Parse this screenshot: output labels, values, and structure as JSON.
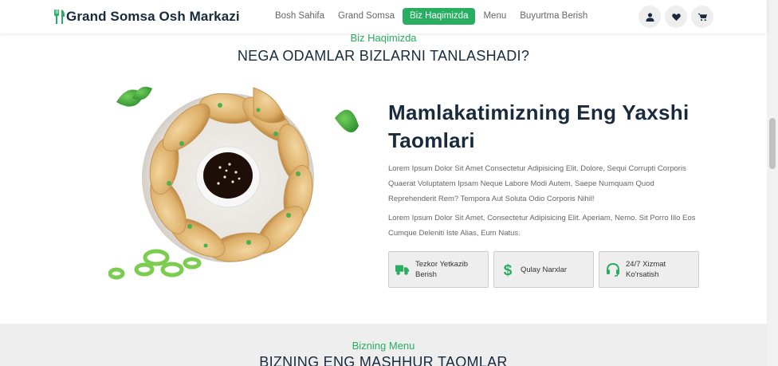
{
  "header": {
    "brand": "Grand Somsa Osh Markazi",
    "nav": [
      {
        "label": "Bosh Sahifa",
        "active": false
      },
      {
        "label": "Grand Somsa",
        "active": false
      },
      {
        "label": "Biz Haqimizda",
        "active": true
      },
      {
        "label": "Menu",
        "active": false
      },
      {
        "label": "Buyurtma Berish",
        "active": false
      }
    ],
    "icons": [
      "user-icon",
      "heart-icon",
      "cart-icon"
    ]
  },
  "about": {
    "subheading": "Biz Haqimizda",
    "heading": "NEGA ODAMLAR BIZLARNI TANLASHADI?",
    "title_line1": "Mamlakatimizning Eng Yaxshi",
    "title_line2": "Taomlari",
    "paragraph1": "Lorem Ipsum Dolor Sit Amet Consectetur Adipisicing Elit. Dolore, Sequi Corrupti Corporis Quaerat Voluptatem Ipsam Neque Labore Modi Autem, Saepe Numquam Quod Reprehenderit Rem? Tempora Aut Soluta Odio Corporis Nihil!",
    "paragraph2": "Lorem Ipsum Dolor Sit Amet, Consectetur Adipisicing Elit. Aperiam, Nemo. Sit Porro Illo Eos Cumque Deleniti Iste Alias, Eum Natus.",
    "features": [
      {
        "label": "Tezkor Yetkazib Berish",
        "icon": "truck-icon"
      },
      {
        "label": "Qulay Narxlar",
        "icon": "dollar-icon"
      },
      {
        "label": "24/7 Xizmat Ko'rsatish",
        "icon": "headset-icon"
      }
    ]
  },
  "menu_section": {
    "subheading": "Bizning Menu",
    "heading": "BIZNING ENG MASHHUR TAOMLAR"
  },
  "colors": {
    "accent": "#27ae60",
    "dark": "#192a3d",
    "muted": "#666666",
    "light_bg": "#eeeeee"
  }
}
